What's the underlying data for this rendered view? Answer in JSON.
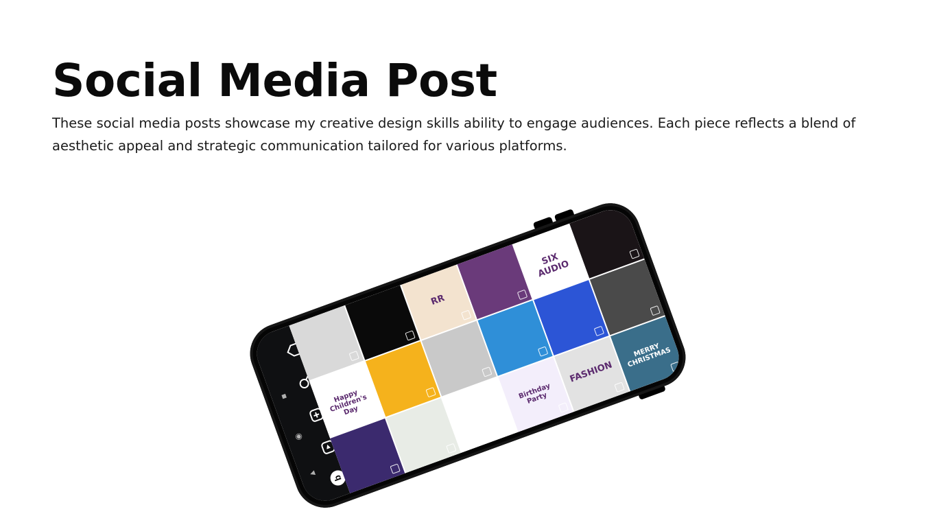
{
  "header": {
    "title": "Social Media Post",
    "description": "These social media posts showcase my creative design skills ability to engage audiences. Each piece reflects a blend of aesthetic appeal and strategic communication tailored for various platforms."
  },
  "phone": {
    "nav_icons": [
      "home-icon",
      "search-icon",
      "add-post-icon",
      "reels-icon",
      "profile-icon"
    ],
    "system_icons": [
      "square-icon",
      "circle-icon",
      "triangle-back-icon"
    ],
    "grid_posts": [
      {
        "name": "post-collage",
        "color": "#d9d9d9",
        "label": ""
      },
      {
        "name": "post-arrows",
        "color": "#0a0a0a",
        "label": ""
      },
      {
        "name": "post-wedding-invite",
        "color": "#f3e3cf",
        "label": "RR"
      },
      {
        "name": "post-neon-animal",
        "color": "#6a3a7a",
        "label": ""
      },
      {
        "name": "post-six-audio",
        "color": "#ffffff",
        "label": "SIX AUDIO"
      },
      {
        "name": "post-fireworks",
        "color": "#1a1417",
        "label": ""
      },
      {
        "name": "post-childrens-day",
        "color": "#ffffff",
        "label": "Happy Children's Day"
      },
      {
        "name": "post-yellow",
        "color": "#f5b21c",
        "label": ""
      },
      {
        "name": "post-ui-mockup",
        "color": "#c9c9c9",
        "label": ""
      },
      {
        "name": "post-parrot",
        "color": "#2f8fd8",
        "label": ""
      },
      {
        "name": "post-blue-card",
        "color": "#2c55d6",
        "label": ""
      },
      {
        "name": "post-devices",
        "color": "#4a4a4a",
        "label": ""
      },
      {
        "name": "post-purple",
        "color": "#3b2a6e",
        "label": ""
      },
      {
        "name": "post-spreadsheet",
        "color": "#e8ece6",
        "label": ""
      },
      {
        "name": "post-infographic",
        "color": "#ffffff",
        "label": ""
      },
      {
        "name": "post-birthday-party",
        "color": "#f3eefb",
        "label": "Birthday Party"
      },
      {
        "name": "post-fashion",
        "color": "#e2e2e2",
        "label": "FASHION"
      },
      {
        "name": "post-christmas",
        "color": "#3a6e8a",
        "label": "MERRY CHRISTMAS"
      }
    ]
  }
}
